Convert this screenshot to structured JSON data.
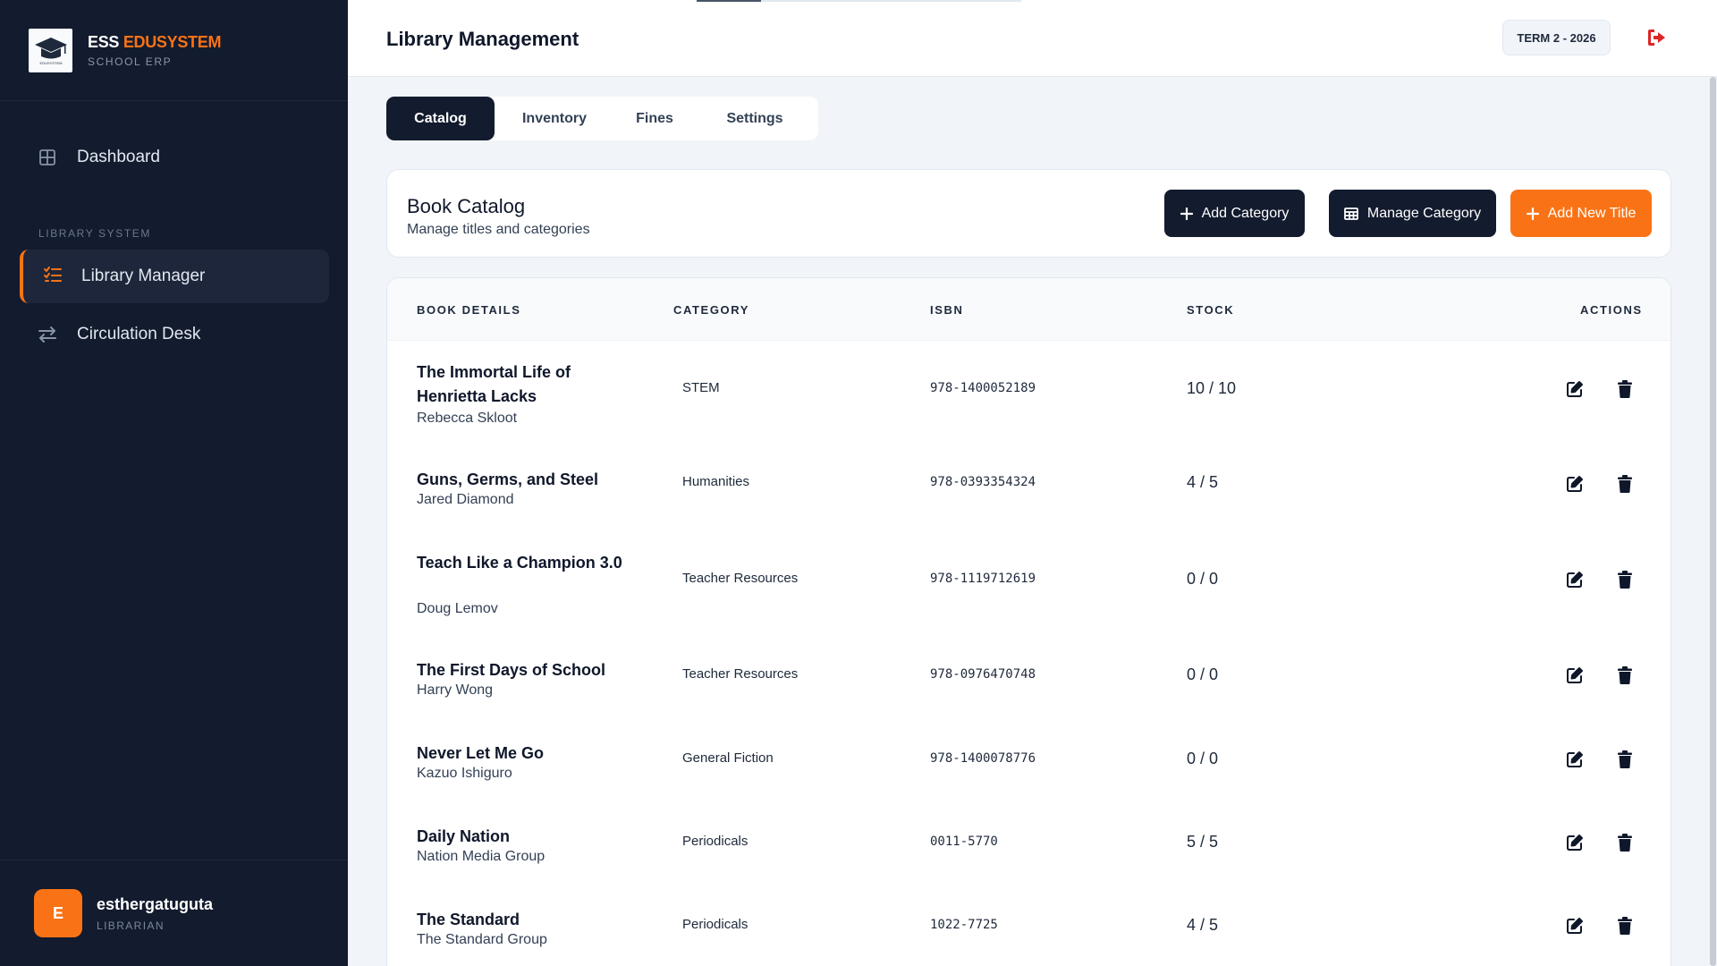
{
  "brand": {
    "name_white": "ESS",
    "name_orange": "EDUSYSTEM",
    "subtitle": "SCHOOL ERP",
    "logo_text": "EDUSYSTEM"
  },
  "sidebar": {
    "dashboard": "Dashboard",
    "section_label": "LIBRARY SYSTEM",
    "library_manager": "Library Manager",
    "circulation_desk": "Circulation Desk"
  },
  "user": {
    "initial": "E",
    "name": "esthergatuguta",
    "role": "LIBRARIAN"
  },
  "header": {
    "title": "Library Management",
    "term": "TERM 2 - 2026"
  },
  "tabs": [
    "Catalog",
    "Inventory",
    "Fines",
    "Settings"
  ],
  "catalog": {
    "title": "Book Catalog",
    "subtitle": "Manage titles and categories",
    "add_category": "Add Category",
    "manage_category": "Manage Category",
    "add_new_title": "Add New Title"
  },
  "table": {
    "headers": {
      "book": "BOOK DETAILS",
      "category": "CATEGORY",
      "isbn": "ISBN",
      "stock": "STOCK",
      "actions": "ACTIONS"
    },
    "rows": [
      {
        "title": "The Immortal Life of Henrietta Lacks",
        "author": "Rebecca Skloot",
        "category": "STEM",
        "isbn": "978-1400052189",
        "stock": "10 / 10"
      },
      {
        "title": "Guns, Germs, and Steel",
        "author": "Jared Diamond",
        "category": "Humanities",
        "isbn": "978-0393354324",
        "stock": "4 / 5"
      },
      {
        "title": "Teach Like a Champion 3.0",
        "author": "Doug Lemov",
        "category": "Teacher Resources",
        "isbn": "978-1119712619",
        "stock": "0 / 0"
      },
      {
        "title": "The First Days of School",
        "author": "Harry Wong",
        "category": "Teacher Resources",
        "isbn": "978-0976470748",
        "stock": "0 / 0"
      },
      {
        "title": "Never Let Me Go",
        "author": "Kazuo Ishiguro",
        "category": "General Fiction",
        "isbn": "978-1400078776",
        "stock": "0 / 0"
      },
      {
        "title": "Daily Nation",
        "author": "Nation Media Group",
        "category": "Periodicals",
        "isbn": "0011-5770",
        "stock": "5 / 5"
      },
      {
        "title": "The Standard",
        "author": "The Standard Group",
        "category": "Periodicals",
        "isbn": "1022-7725",
        "stock": "4 / 5"
      }
    ]
  },
  "colors": {
    "sidebar_bg": "#131b2e",
    "accent": "#f97316",
    "logout": "#dc2626"
  },
  "icons": {
    "dashboard": "grid-icon",
    "library": "list-check-icon",
    "circulation": "arrows-exchange-icon",
    "logout": "logout-icon",
    "edit": "edit-icon",
    "delete": "trash-icon",
    "plus": "plus-icon",
    "table": "table-icon"
  }
}
